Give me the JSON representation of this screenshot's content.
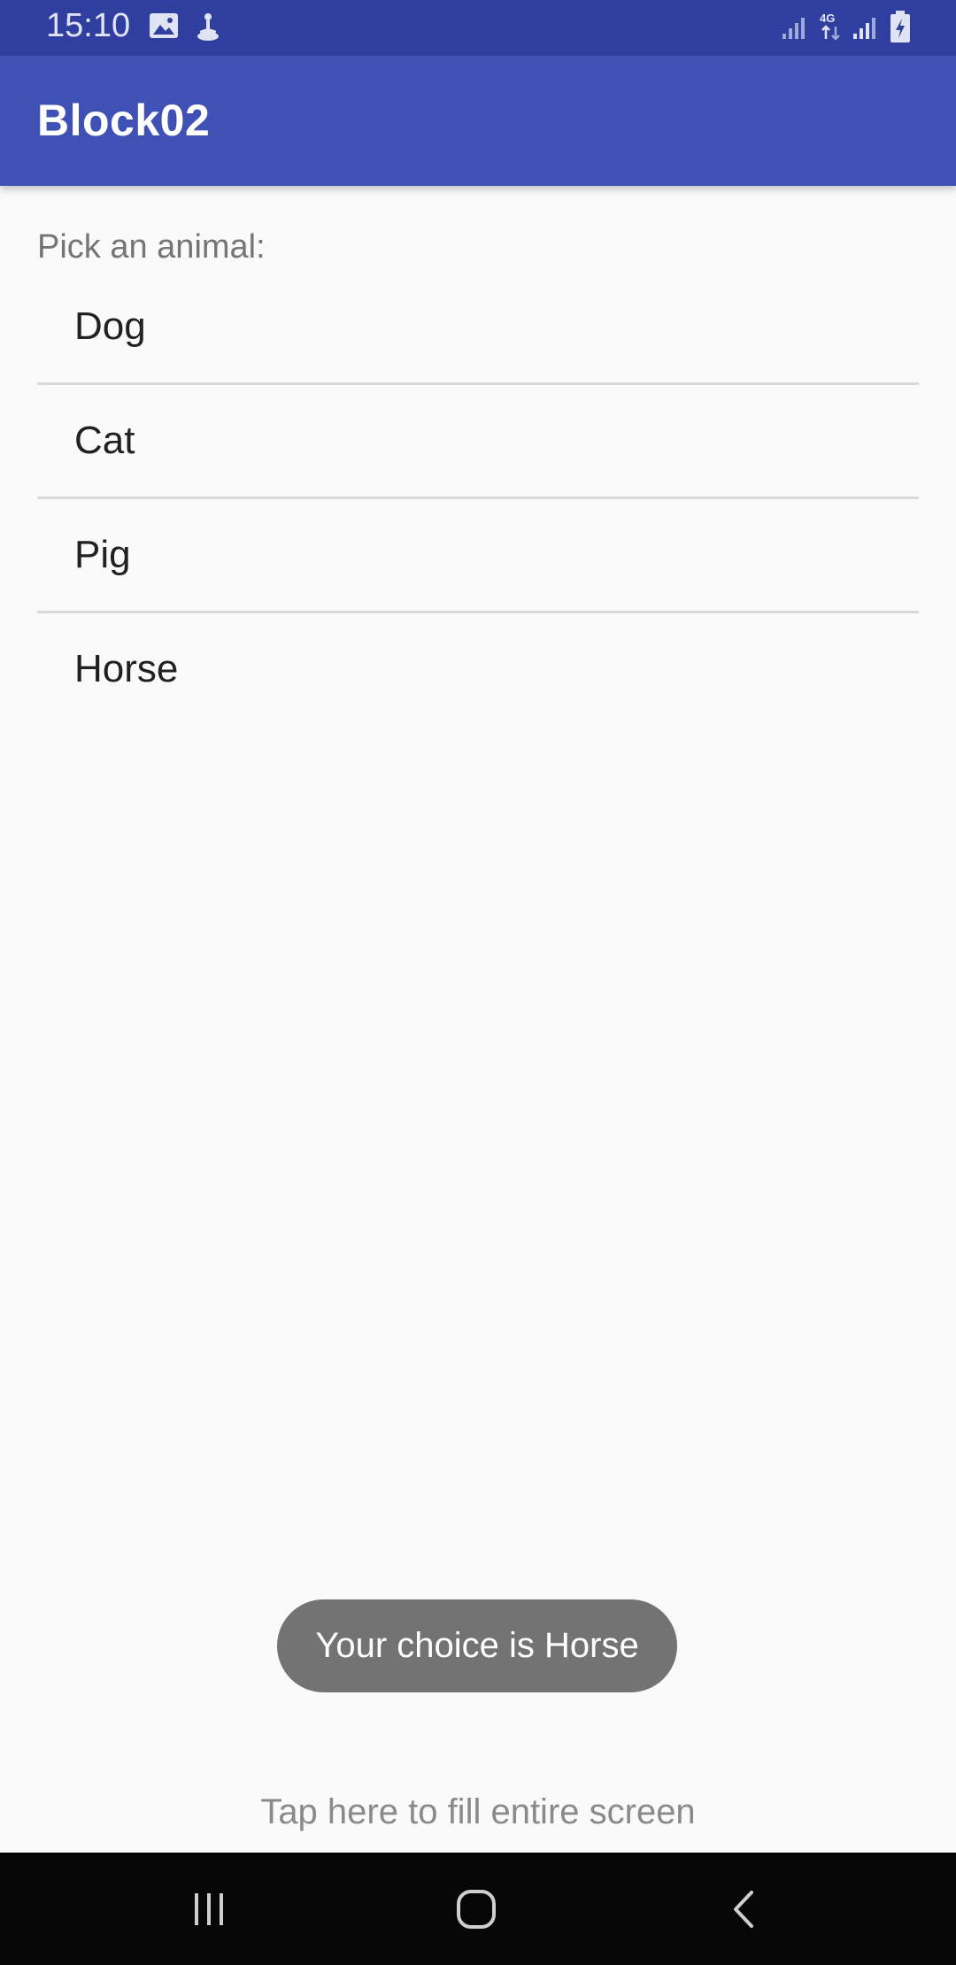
{
  "status_bar": {
    "time": "15:10",
    "icons": [
      "image-icon",
      "accessibility-icon",
      "signal-icon",
      "4g-icon",
      "signal-icon",
      "battery-charging-icon"
    ],
    "network_label": "4G",
    "color": "#303f9f"
  },
  "app_bar": {
    "title": "Block02",
    "color": "#3f51b5"
  },
  "main": {
    "prompt": "Pick an animal:",
    "items": [
      {
        "label": "Dog"
      },
      {
        "label": "Cat"
      },
      {
        "label": "Pig"
      },
      {
        "label": "Horse"
      }
    ]
  },
  "toast": {
    "text": "Your choice is Horse"
  },
  "footer": {
    "fill_text": "Tap here to fill entire screen"
  },
  "nav_bar": {
    "icons": [
      "recents-icon",
      "home-icon",
      "back-icon"
    ]
  }
}
